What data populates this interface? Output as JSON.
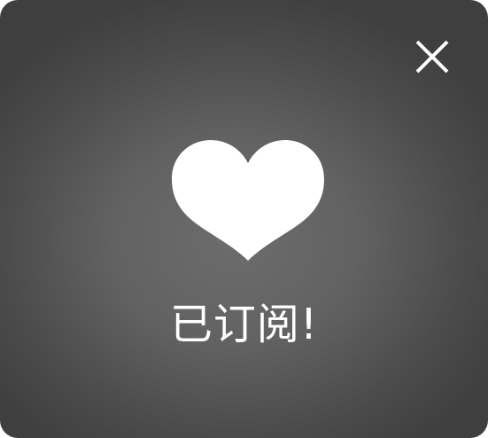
{
  "dialog": {
    "message": "已订阅!",
    "close_icon": "close-icon",
    "heart_icon": "heart-icon"
  },
  "colors": {
    "text": "#ffffff",
    "icon": "#ffffff",
    "background_center": "#6c6c6c",
    "background_edge": "#3f3f3f"
  }
}
